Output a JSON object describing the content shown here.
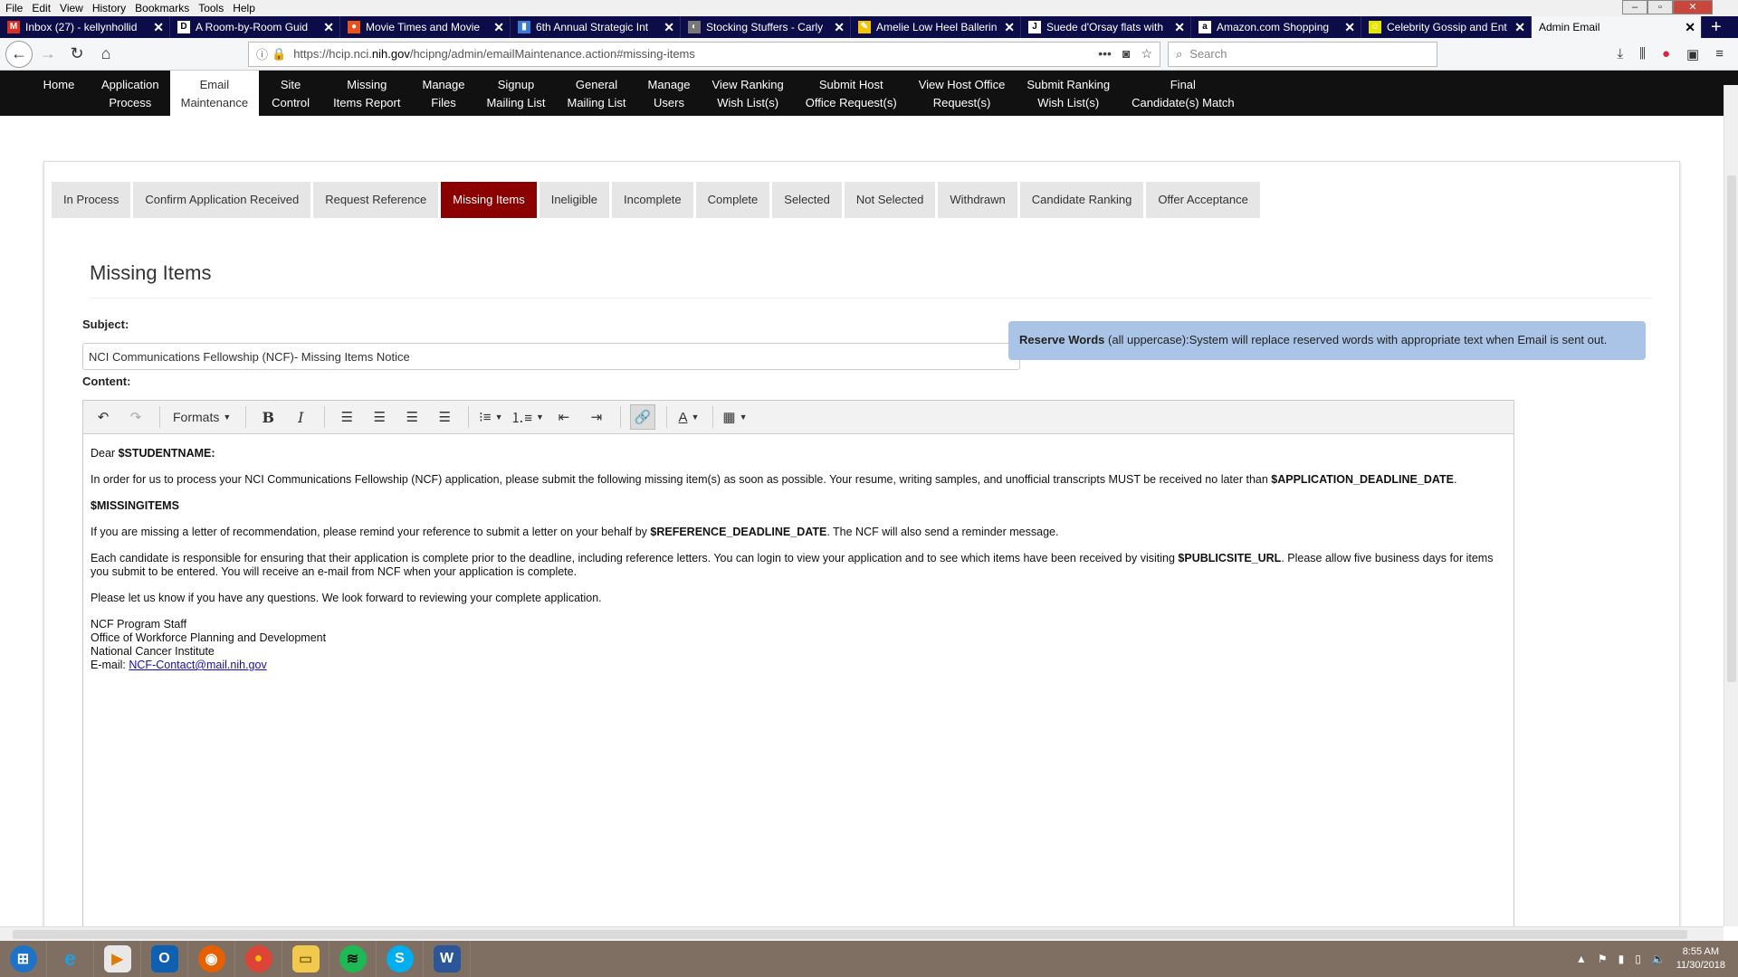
{
  "browser": {
    "menu": [
      "File",
      "Edit",
      "View",
      "History",
      "Bookmarks",
      "Tools",
      "Help"
    ],
    "tabs": [
      {
        "title": "Inbox (27) - kellynhollid",
        "icon": "gmail-icon",
        "color": "#d93025",
        "glyph": "M"
      },
      {
        "title": "A Room-by-Room Guid",
        "icon": "d-logo-icon",
        "color": "#ffffff",
        "glyph": "D"
      },
      {
        "title": "Movie Times and Movie",
        "icon": "tomato-icon",
        "color": "#e8501c",
        "glyph": "●"
      },
      {
        "title": "6th Annual Strategic Int",
        "icon": "chart-icon",
        "color": "#3a7bd5",
        "glyph": "▮"
      },
      {
        "title": "Stocking Stuffers - Carly",
        "icon": "loading-icon",
        "color": "#777777",
        "glyph": "◐"
      },
      {
        "title": "Amelie Low Heel Ballerin",
        "icon": "shoe-icon",
        "color": "#f4c400",
        "glyph": "✎"
      },
      {
        "title": "Suede d'Orsay flats with",
        "icon": "j-logo-icon",
        "color": "#ffffff",
        "glyph": "J"
      },
      {
        "title": "Amazon.com Shopping",
        "icon": "amazon-icon",
        "color": "#ffffff",
        "glyph": "a"
      },
      {
        "title": "Celebrity Gossip and Ent",
        "icon": "smiley-icon",
        "color": "#e5e600",
        "glyph": "☺"
      },
      {
        "title": "Admin Email",
        "icon": "",
        "color": "",
        "glyph": ""
      }
    ],
    "url": {
      "prefix": "https://hcip.nci.",
      "host": "nih.gov",
      "path": "/hcipng/admin/emailMaintenance.action#missing-items"
    },
    "search_placeholder": "Search"
  },
  "sitenav": [
    {
      "label": "Home"
    },
    {
      "label": "Application\nProcess"
    },
    {
      "label": "Email\nMaintenance",
      "active": true
    },
    {
      "label": "Site\nControl"
    },
    {
      "label": "Missing\nItems Report"
    },
    {
      "label": "Manage\nFiles"
    },
    {
      "label": "Signup\nMailing List"
    },
    {
      "label": "General\nMailing List"
    },
    {
      "label": "Manage\nUsers"
    },
    {
      "label": "View Ranking\nWish List(s)"
    },
    {
      "label": "Submit Host\nOffice Request(s)"
    },
    {
      "label": "View Host Office\nRequest(s)"
    },
    {
      "label": "Submit Ranking\nWish List(s)"
    },
    {
      "label": "Final\nCandidate(s) Match"
    }
  ],
  "status_tabs": [
    "In Process",
    "Confirm Application Received",
    "Request Reference",
    "Missing Items",
    "Ineligible",
    "Incomplete",
    "Complete",
    "Selected",
    "Not Selected",
    "Withdrawn",
    "Candidate Ranking",
    "Offer Acceptance"
  ],
  "active_status_tab": "Missing Items",
  "section_title": "Missing Items",
  "form": {
    "subject_label": "Subject:",
    "subject_value": "NCI Communications Fellowship (NCF)- Missing Items Notice",
    "content_label": "Content:",
    "reserve_words_bold": "Reserve Words",
    "reserve_words_text": " (all uppercase):System will replace reserved words with appropriate text when Email is sent out."
  },
  "editor": {
    "formats_label": "Formats",
    "greeting": "Dear ",
    "greeting_var": "$STUDENTNAME:",
    "p1_text": "In order for us to process your NCI Communications Fellowship (NCF) application, please submit the following missing item(s) as soon as possible. Your resume, writing samples, and unofficial transcripts MUST be received no later than ",
    "p1_var": "$APPLICATION_DEADLINE_DATE",
    "p1_end": ".",
    "p2_var": "$MISSINGITEMS",
    "p3_text": "If you are missing a letter of recommendation, please remind your reference to submit a letter on your behalf by ",
    "p3_var": "$REFERENCE_DEADLINE_DATE",
    "p3_end": ". The NCF will also send a reminder message.",
    "p4_text": "Each candidate is responsible for ensuring that their application is complete prior to the deadline, including reference letters. You can login to view your application and to see which items have been received by visiting ",
    "p4_var": "$PUBLICSITE_URL",
    "p4_end": ". Please allow five business days for items you submit to be entered. You will receive an e-mail from NCF when your application is complete.",
    "p5_text": "Please let us know if you have any questions. We look forward to reviewing your complete application.",
    "sig1": "NCF Program Staff",
    "sig2": "Office of Workforce Planning and Development",
    "sig3": "National Cancer Institute",
    "sig4_label": "E-mail: ",
    "sig4_link": "NCF-Contact@mail.nih.gov"
  },
  "taskbar": {
    "apps": [
      "windows-start-icon",
      "internet-explorer-icon",
      "media-player-icon",
      "outlook-icon",
      "firefox-icon",
      "chrome-icon",
      "file-explorer-icon",
      "spotify-icon",
      "skype-icon",
      "word-icon"
    ],
    "time": "8:55 AM",
    "date": "11/30/2018"
  },
  "colors": {
    "accent_tab": "#8b0000",
    "reserve_bg": "#a9c4e6",
    "sitenav_bg": "#111111"
  }
}
